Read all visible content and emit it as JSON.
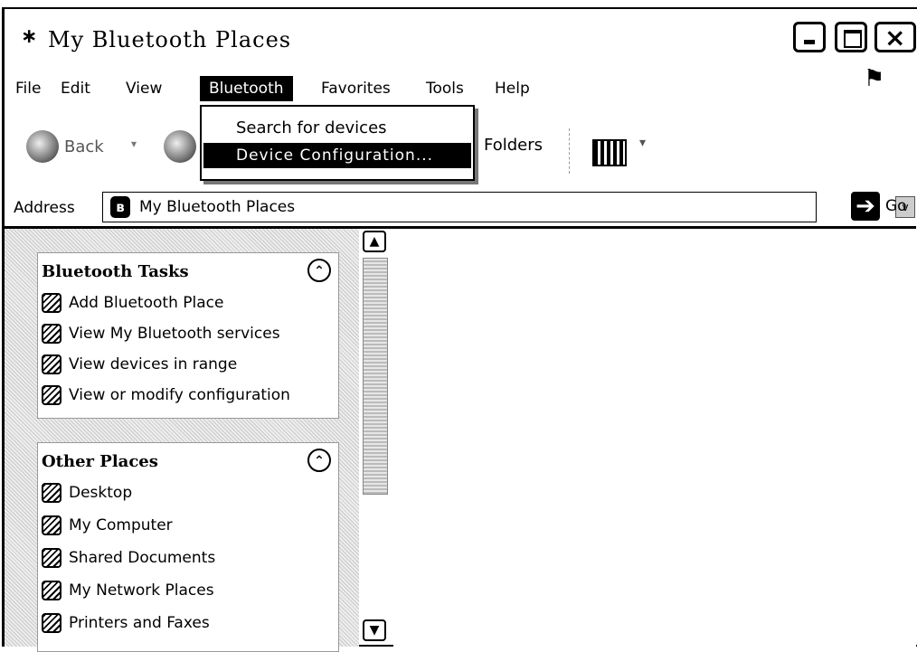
{
  "window": {
    "title_glyph": "∗",
    "title": "My Bluetooth Places",
    "controls": {
      "minimize": "minimize",
      "maximize": "maximize",
      "close": "×"
    }
  },
  "menubar": {
    "items": [
      "File",
      "Edit",
      "View",
      "Bluetooth",
      "Favorites",
      "Tools",
      "Help"
    ],
    "active": "Bluetooth"
  },
  "bluetooth_menu": {
    "items": [
      "Search for devices",
      "Device Configuration..."
    ],
    "highlighted": "Device Configuration..."
  },
  "toolbar": {
    "back_label": "Back",
    "back_dropdown": "▾",
    "folders_label": "Folders",
    "views_dropdown": "▾"
  },
  "address": {
    "label": "Address",
    "badge": "ʙ",
    "value": "My Bluetooth Places",
    "dropdown": "v",
    "go_label": "Go",
    "go_glyph": "➔"
  },
  "panels": {
    "bluetooth_tasks": {
      "title": "Bluetooth Tasks",
      "collapse": "⌃",
      "items": [
        "Add Bluetooth Place",
        "View My Bluetooth services",
        "View devices in range",
        "View or modify configuration"
      ]
    },
    "other_places": {
      "title": "Other Places",
      "collapse": "⌃",
      "items": [
        "Desktop",
        "My Computer",
        "Shared Documents",
        "My Network Places",
        "Printers and Faxes"
      ]
    }
  },
  "scrollbar": {
    "up": "▲",
    "down": "▼"
  },
  "icons": {
    "title": "bluetooth-icon",
    "back": "back-arrow-icon",
    "forward": "forward-arrow-icon",
    "views": "views-icon",
    "go": "go-arrow-icon",
    "windows_logo": "windows-flag-icon"
  }
}
